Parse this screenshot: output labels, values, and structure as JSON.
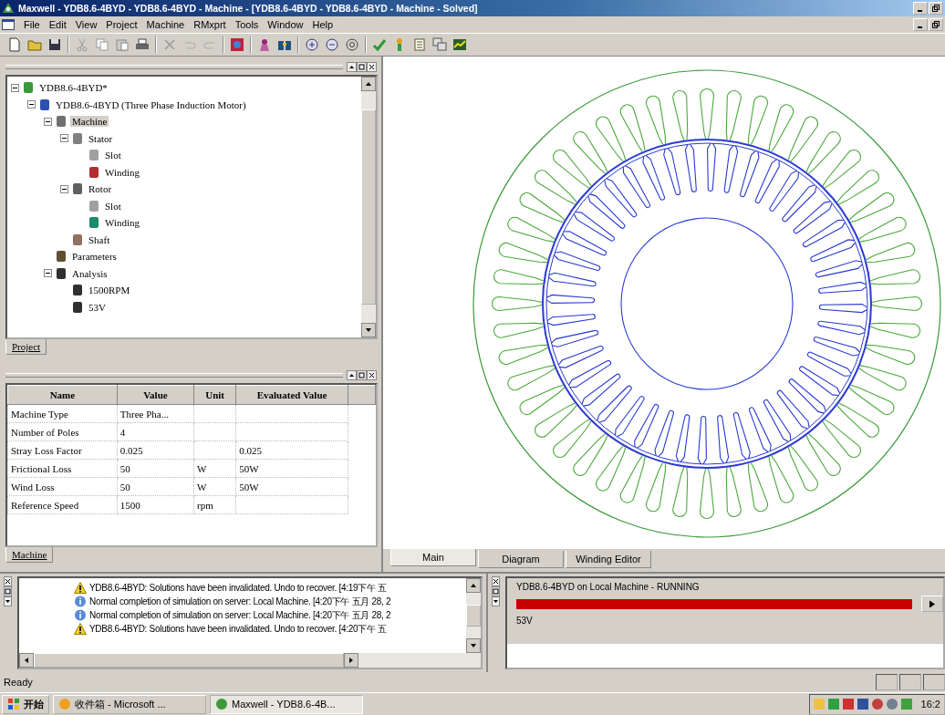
{
  "window": {
    "title": "Maxwell - YDB8.6-4BYD - YDB8.6-4BYD - Machine - [YDB8.6-4BYD - YDB8.6-4BYD - Machine - Solved]"
  },
  "menu": [
    "File",
    "Edit",
    "View",
    "Project",
    "Machine",
    "RMxprt",
    "Tools",
    "Window",
    "Help"
  ],
  "tree": [
    {
      "label": "YDB8.6-4BYD*",
      "expanded": true,
      "selected": false,
      "children": [
        {
          "label": "YDB8.6-4BYD (Three Phase Induction Motor)",
          "expanded": true,
          "selected": false,
          "children": [
            {
              "label": "Machine",
              "expanded": true,
              "selected": true,
              "children": [
                {
                  "label": "Stator",
                  "expanded": true,
                  "selected": false,
                  "children": [
                    {
                      "label": "Slot",
                      "selected": false
                    },
                    {
                      "label": "Winding",
                      "selected": false
                    }
                  ]
                },
                {
                  "label": "Rotor",
                  "expanded": true,
                  "selected": false,
                  "children": [
                    {
                      "label": "Slot",
                      "selected": false
                    },
                    {
                      "label": "Winding",
                      "selected": false
                    }
                  ]
                },
                {
                  "label": "Shaft",
                  "selected": false
                }
              ]
            },
            {
              "label": "Parameters",
              "selected": false
            },
            {
              "label": "Analysis",
              "expanded": true,
              "selected": false,
              "children": [
                {
                  "label": "1500RPM",
                  "selected": false
                },
                {
                  "label": "53V",
                  "selected": false
                }
              ]
            }
          ]
        }
      ]
    }
  ],
  "project_tab": "Project",
  "table": {
    "columns": [
      "Name",
      "Value",
      "Unit",
      "Evaluated Value"
    ],
    "rows": [
      [
        "Machine Type",
        "Three Pha...",
        "",
        ""
      ],
      [
        "Number of Poles",
        "4",
        "",
        ""
      ],
      [
        "Stray Loss Factor",
        "0.025",
        "",
        "0.025"
      ],
      [
        "Frictional Loss",
        "50",
        "W",
        "50W"
      ],
      [
        "Wind Loss",
        "50",
        "W",
        "50W"
      ],
      [
        "Reference Speed",
        "1500",
        "rpm",
        ""
      ]
    ]
  },
  "machine_tab": "Machine",
  "view_tabs": [
    {
      "label": "Main",
      "selected": true
    },
    {
      "label": "Diagram",
      "selected": false
    },
    {
      "label": "Winding Editor",
      "selected": false
    }
  ],
  "messages": [
    {
      "kind": "warning",
      "text": "YDB8.6-4BYD: Solutions have been invalidated. Undo to recover. [4:19下午 五"
    },
    {
      "kind": "info",
      "text": "Normal completion of simulation on server: Local Machine. [4:20下午 五月 28, 2"
    },
    {
      "kind": "info",
      "text": "Normal completion of simulation on server: Local Machine. [4:20下午 五月 28, 2"
    },
    {
      "kind": "warning",
      "text": "YDB8.6-4BYD: Solutions have been invalidated. Undo to recover. [4:20下午 五"
    }
  ],
  "progress": {
    "title": "YDB8.6-4BYD on Local Machine - RUNNING",
    "level": 1,
    "label": "53V"
  },
  "status_bar": {
    "text": "Ready"
  },
  "taskbar": {
    "start": "开始",
    "items": [
      {
        "label": "收件箱 - Microsoft ...",
        "selected": false
      },
      {
        "label": "Maxwell - YDB8.6-4B...",
        "selected": true
      }
    ],
    "clock": "16:2"
  }
}
